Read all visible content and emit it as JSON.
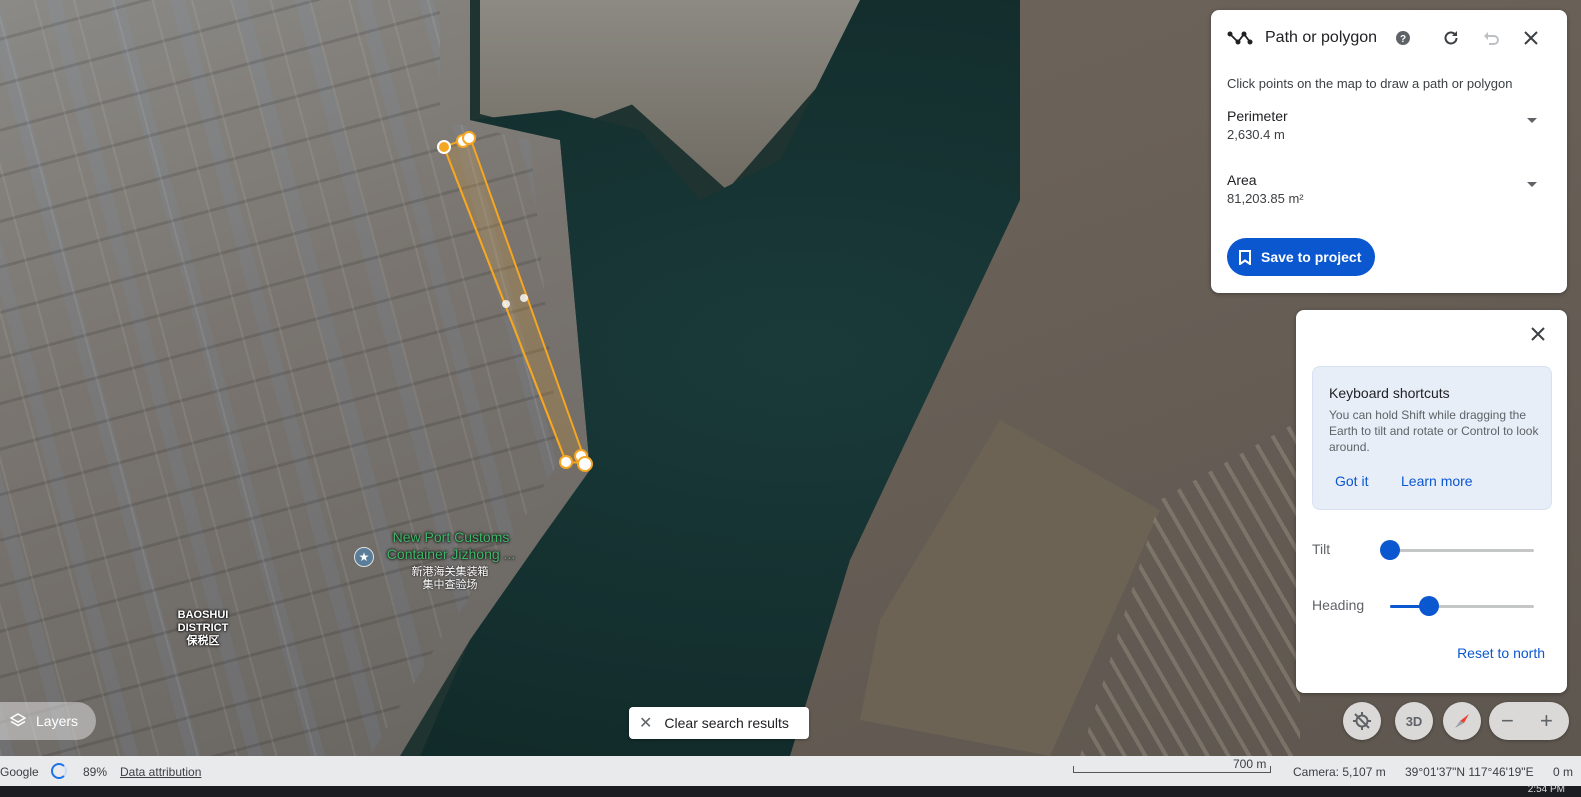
{
  "tool": {
    "title": "Path or polygon",
    "description": "Click points on the map to draw a path or polygon",
    "perimeter_label": "Perimeter",
    "perimeter_value": "2,630.4 m",
    "area_label": "Area",
    "area_value": "81,203.85 m²",
    "save_label": "Save to project"
  },
  "navigation": {
    "shortcut_title": "Keyboard shortcuts",
    "shortcut_text": "You can hold Shift while dragging the Earth to tilt and rotate or Control to look around.",
    "got_it_label": "Got it",
    "learn_more_label": "Learn more",
    "tilt_label": "Tilt",
    "tilt_level": 0.0,
    "heading_label": "Heading",
    "heading_level": 0.27,
    "reset_label": "Reset to north"
  },
  "map": {
    "poi_name_line1": "New Port Customs",
    "poi_name_line2": "Container Jizhong ...",
    "poi_chinese_line1": "新港海关集装箱",
    "poi_chinese_line2": "集中查验场",
    "district_line1": "BAOSHUI",
    "district_line2": "DISTRICT",
    "district_line3": "保税区",
    "measure_color": "#f5a623"
  },
  "controls": {
    "layers_label": "Layers",
    "clear_search_label": "Clear search results",
    "btn_3d_label": "3D",
    "zoom_out_label": "−",
    "zoom_in_label": "+"
  },
  "status": {
    "brand": "Google",
    "loading_percent": "89%",
    "data_attribution": "Data attribution",
    "scale_label": "700 m",
    "camera": "Camera: 5,107 m",
    "coordinates": "39°01'37\"N 117°46'19\"E",
    "elevation": "0 m"
  },
  "taskbar": {
    "clock": "2:54 PM"
  }
}
